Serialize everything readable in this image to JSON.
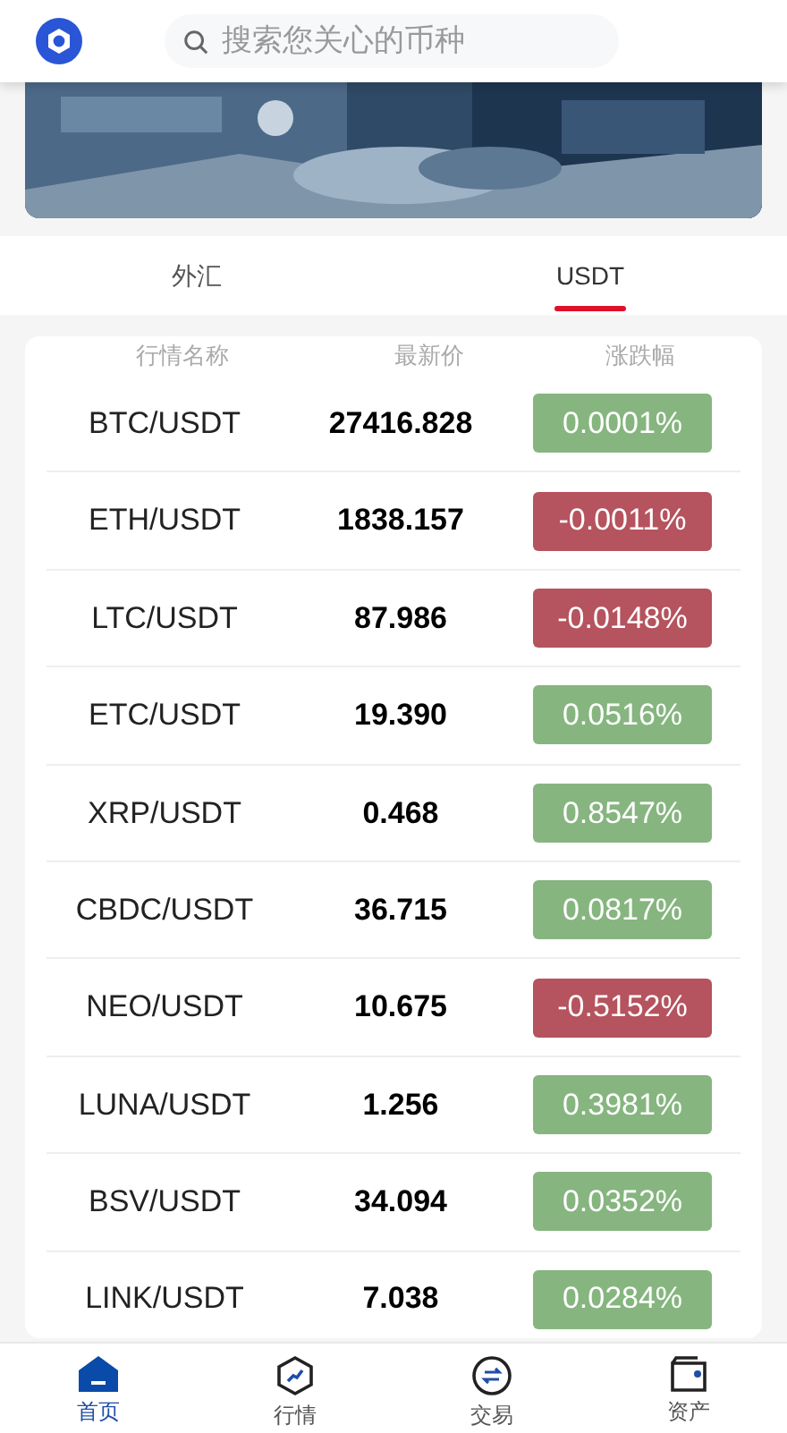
{
  "header": {
    "search": {
      "placeholder": "搜索您关心的币种"
    }
  },
  "tabs": [
    {
      "label": "外汇",
      "selected": false
    },
    {
      "label": "USDT",
      "selected": true
    }
  ],
  "table": {
    "columns": [
      "行情名称",
      "最新价",
      "涨跌幅"
    ],
    "rows": [
      {
        "name": "BTC/USDT",
        "price": "27416.828",
        "change": "0.0001%",
        "color": "#86b57f"
      },
      {
        "name": "ETH/USDT",
        "price": "1838.157",
        "change": "-0.0011%",
        "color": "#b5535e"
      },
      {
        "name": "LTC/USDT",
        "price": "87.986",
        "change": "-0.0148%",
        "color": "#b5535e"
      },
      {
        "name": "ETC/USDT",
        "price": "19.390",
        "change": "0.0516%",
        "color": "#86b57f"
      },
      {
        "name": "XRP/USDT",
        "price": "0.468",
        "change": "0.8547%",
        "color": "#86b57f"
      },
      {
        "name": "CBDC/USDT",
        "price": "36.715",
        "change": "0.0817%",
        "color": "#86b57f"
      },
      {
        "name": "NEO/USDT",
        "price": "10.675",
        "change": "-0.5152%",
        "color": "#b5535e"
      },
      {
        "name": "LUNA/USDT",
        "price": "1.256",
        "change": "0.3981%",
        "color": "#86b57f"
      },
      {
        "name": "BSV/USDT",
        "price": "34.094",
        "change": "0.0352%",
        "color": "#86b57f"
      },
      {
        "name": "LINK/USDT",
        "price": "7.038",
        "change": "0.0284%",
        "color": "#86b57f"
      }
    ]
  },
  "bottom_nav": [
    {
      "label": "首页",
      "kind": "home",
      "selected": true
    },
    {
      "label": "行情",
      "kind": "market",
      "selected": false
    },
    {
      "label": "交易",
      "kind": "trade",
      "selected": false
    },
    {
      "label": "资产",
      "kind": "assets",
      "selected": false
    }
  ]
}
